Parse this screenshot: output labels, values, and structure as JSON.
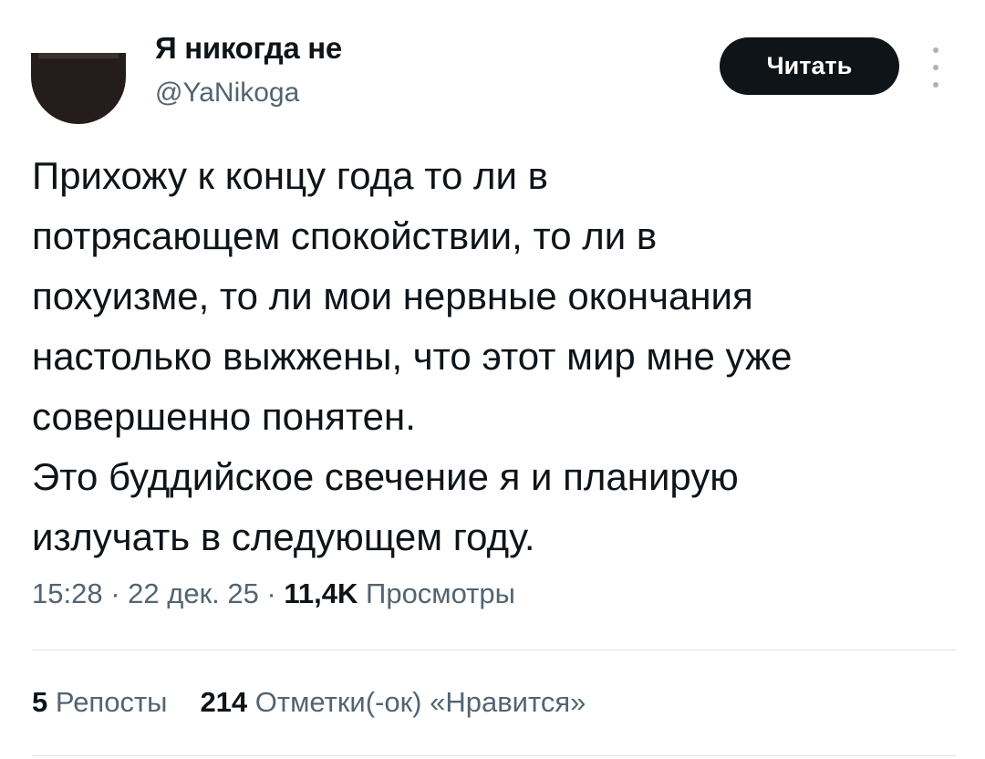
{
  "author": {
    "display_name": "Я никогда не",
    "handle": "@YaNikoga"
  },
  "actions": {
    "follow_label": "Читать",
    "more_icon": "more-vertical-icon"
  },
  "tweet": {
    "lines": [
      "Прихожу к концу года то ли в",
      "потрясающем спокойствии, то ли в",
      "похуизме, то ли мои нервные окончания",
      "настолько выжжены, что этот мир мне уже",
      "совершенно понятен.",
      "Это буддийское свечение я и планирую",
      "излучать в следующем году."
    ]
  },
  "meta": {
    "time": "15:28",
    "separator": " · ",
    "date": "22 дек. 25",
    "views_count": "11,4K",
    "views_label": "Просмотры"
  },
  "stats": {
    "reposts_count": "5",
    "reposts_label": "Репосты",
    "likes_count": "214",
    "likes_label": "Отметки(-ок) «Нравится»"
  },
  "colors": {
    "text_primary": "#0f1419",
    "text_secondary": "#536471",
    "button_bg": "#0f1419",
    "divider": "#dde3e8"
  }
}
